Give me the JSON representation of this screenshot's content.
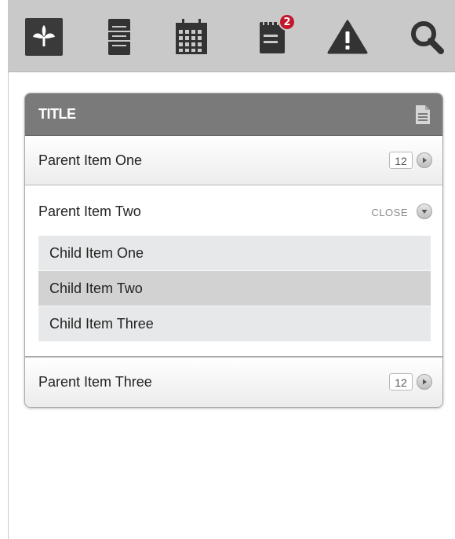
{
  "toolbar": {
    "icons": [
      "leaf-icon",
      "filing-cabinet-icon",
      "calendar-icon",
      "notepad-icon",
      "warning-icon",
      "search-icon"
    ],
    "notifications_badge": "2",
    "colors": {
      "background": "#c9c9c9",
      "icon": "#333333",
      "badge": "#c4162a"
    }
  },
  "panel": {
    "title": "TITLE",
    "header_color": "#7a7a7a",
    "items": [
      {
        "label": "Parent Item One",
        "count": "12"
      },
      {
        "label": "Parent Item Two",
        "close_label": "CLOSE",
        "children": [
          {
            "label": "Child Item One",
            "selected": false
          },
          {
            "label": "Child Item Two",
            "selected": true
          },
          {
            "label": "Child Item Three",
            "selected": false
          }
        ]
      },
      {
        "label": "Parent Item Three",
        "count": "12"
      }
    ]
  }
}
